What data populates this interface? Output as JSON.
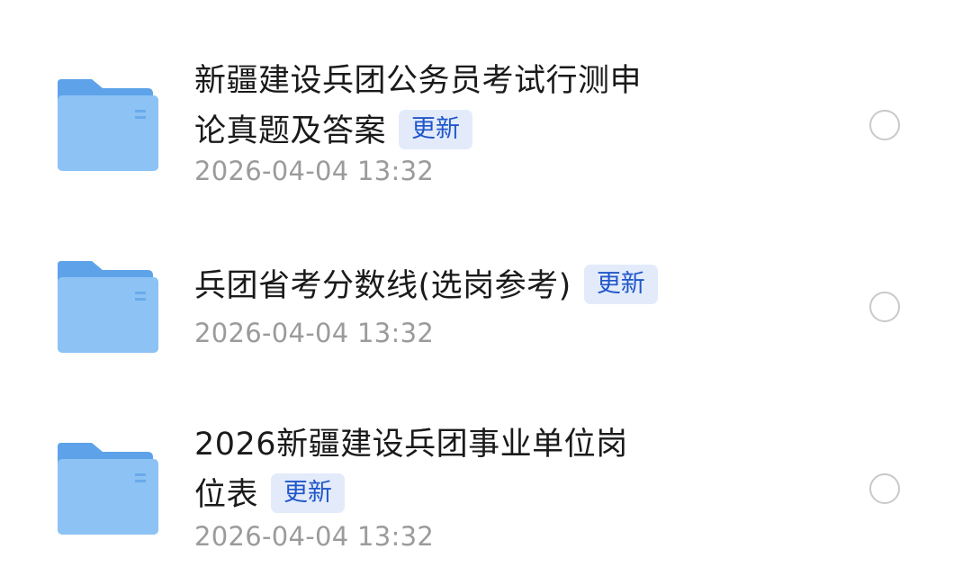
{
  "files": [
    {
      "title_line1": "新疆建设兵团公务员考试行测申",
      "title_line2": "论真题及答案",
      "badge": "更新",
      "timestamp": "2026-04-04 13:32",
      "icon": "folder-icon"
    },
    {
      "title_line1": "兵团省考分数线(选岗参考)",
      "badge": "更新",
      "timestamp": "2026-04-04 13:32",
      "icon": "folder-icon"
    },
    {
      "title_line1": "2026新疆建设兵团事业单位岗",
      "title_line2": "位表",
      "badge": "更新",
      "timestamp": "2026-04-04 13:32",
      "icon": "folder-icon"
    }
  ],
  "colors": {
    "folder_back": "#5ea3e9",
    "folder_front": "#8cc3f4",
    "badge_text": "#1f56c9",
    "badge_bg": "#e3ebfb",
    "timestamp": "#9b9b9b",
    "radio_border": "#c9c9c9"
  }
}
